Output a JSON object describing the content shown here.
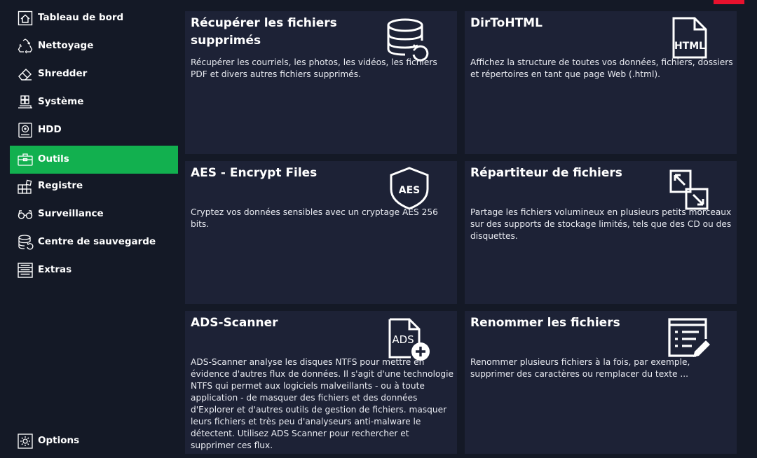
{
  "window": {
    "accent_color": "#e8112d"
  },
  "sidebar": {
    "active_color": "#12b04f",
    "items": [
      {
        "label": "Tableau de bord",
        "icon": "home-icon"
      },
      {
        "label": "Nettoyage",
        "icon": "recycle-icon"
      },
      {
        "label": "Shredder",
        "icon": "eraser-icon"
      },
      {
        "label": "Système",
        "icon": "windows-icon"
      },
      {
        "label": "HDD",
        "icon": "hdd-icon"
      },
      {
        "label": "Outils",
        "icon": "toolbox-icon",
        "active": true
      },
      {
        "label": "Registre",
        "icon": "registry-icon"
      },
      {
        "label": "Surveillance",
        "icon": "glasses-icon"
      },
      {
        "label": "Centre de sauvegarde",
        "icon": "backup-icon"
      },
      {
        "label": "Extras",
        "icon": "extras-list-icon"
      }
    ],
    "options": {
      "label": "Options",
      "icon": "gear-icon"
    }
  },
  "tools": [
    {
      "title": "Récupérer les fichiers supprimés",
      "description": "Récupérer les courriels, les photos, les vidéos, les fichiers PDF et divers autres fichiers supprimés.",
      "icon": "database-restore-icon"
    },
    {
      "title": "DirToHTML",
      "description": "Affichez la structure de toutes vos données, fichiers, dossiers et répertoires en tant que page Web (.html).",
      "icon": "html-file-icon",
      "icon_text": "HTML"
    },
    {
      "title": "AES - Encrypt Files",
      "description": "Cryptez vos données sensibles avec un cryptage AES 256 bits.",
      "icon": "aes-shield-icon",
      "icon_text": "AES"
    },
    {
      "title": "Répartiteur de fichiers",
      "description": "Partage les fichiers volumineux en plusieurs petits morceaux sur des supports de stockage limités, tels que des CD ou des disquettes.",
      "icon": "file-split-icon"
    },
    {
      "title": "ADS-Scanner",
      "description": "ADS-Scanner analyse les disques NTFS pour mettre en évidence d'autres flux de données. Il s'agit d'une technologie NTFS qui permet aux logiciels malveillants - ou à toute application - de masquer des fichiers et des données d'Explorer et d'autres outils de gestion de fichiers. masquer leurs fichiers et très peu d'analyseurs anti-malware le détectent. Utilisez ADS Scanner pour rechercher et supprimer ces flux.",
      "icon": "ads-file-add-icon",
      "icon_text": "ADS"
    },
    {
      "title": "Renommer les fichiers",
      "description": "Renommer plusieurs fichiers à la fois, par exemple, supprimer des caractères ou remplacer du texte ...",
      "icon": "rename-list-icon"
    }
  ]
}
